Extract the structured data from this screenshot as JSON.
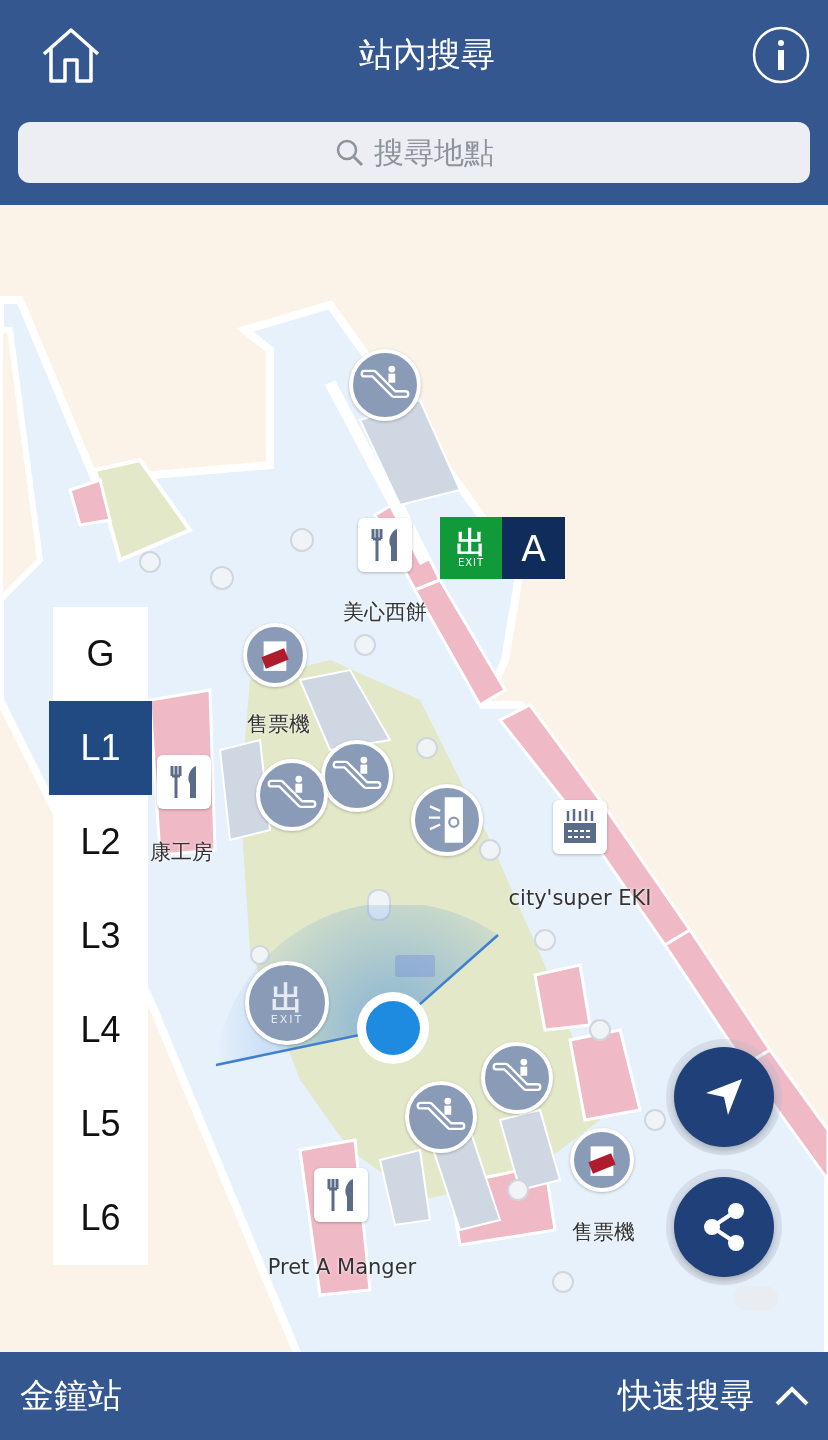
{
  "header": {
    "title": "站內搜尋",
    "search": {
      "placeholder": "搜尋地點"
    }
  },
  "map": {
    "pins": [
      {
        "kind": "escalator"
      },
      {
        "kind": "restaurant"
      },
      {
        "kind": "ticket"
      },
      {
        "kind": "escalator"
      },
      {
        "kind": "restaurant"
      },
      {
        "kind": "escalator"
      },
      {
        "kind": "gate"
      },
      {
        "kind": "shop"
      },
      {
        "kind": "exit",
        "glyph": "出",
        "caption": "EXIT"
      },
      {
        "kind": "escalator"
      },
      {
        "kind": "escalator"
      },
      {
        "kind": "ticket"
      },
      {
        "kind": "restaurant"
      }
    ],
    "labels": [
      {
        "text": "美心西餅"
      },
      {
        "text": "售票機"
      },
      {
        "text": "康工房"
      },
      {
        "text": "city'super EKI"
      },
      {
        "text": "售票機"
      },
      {
        "text": "Pret A Manger"
      }
    ],
    "exit_sign": {
      "glyph": "出",
      "caption": "EXIT",
      "gate": "A"
    }
  },
  "floors": [
    {
      "label": "G",
      "selected": false
    },
    {
      "label": "L1",
      "selected": true
    },
    {
      "label": "L2",
      "selected": false
    },
    {
      "label": "L3",
      "selected": false
    },
    {
      "label": "L4",
      "selected": false
    },
    {
      "label": "L5",
      "selected": false
    },
    {
      "label": "L6",
      "selected": false
    }
  ],
  "bottom_bar": {
    "station": "金鐘站",
    "quick_search": "快速搜尋"
  }
}
